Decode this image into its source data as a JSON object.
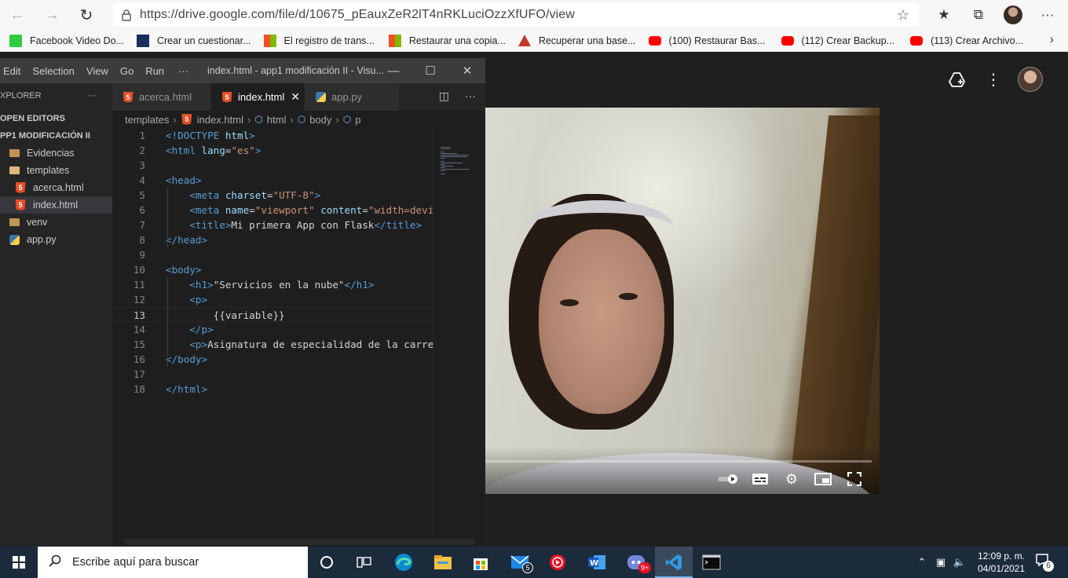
{
  "browser": {
    "url": "https://drive.google.com/file/d/10675_pEauxZeR2lT4nRKLuciOzzXfUFO/view",
    "bookmarks": [
      {
        "label": "Facebook Video Do...",
        "icon": "download-icon",
        "color": "#2ecc40"
      },
      {
        "label": "Crear un cuestionar...",
        "icon": "form-icon",
        "color": "#1b2f5e"
      },
      {
        "label": "El registro de trans...",
        "icon": "windows-icon",
        "color": "#f25022"
      },
      {
        "label": "Restaurar una copia...",
        "icon": "windows-icon",
        "color": "#f25022"
      },
      {
        "label": "Recuperar una base...",
        "icon": "triangle-icon",
        "color": "#c0392b"
      },
      {
        "label": "(100) Restaurar Bas...",
        "icon": "youtube-icon",
        "color": "#ff0000"
      },
      {
        "label": "(112) Crear Backup...",
        "icon": "youtube-icon",
        "color": "#ff0000"
      },
      {
        "label": "(113) Crear Archivo...",
        "icon": "youtube-icon",
        "color": "#ff0000"
      }
    ]
  },
  "vscode": {
    "menu": [
      "Edit",
      "Selection",
      "View",
      "Go",
      "Run",
      "···"
    ],
    "title": "index.html - app1 modificación II - Visu...",
    "explorer": {
      "header": "XPLORER",
      "more": "···",
      "open_editors": "OPEN EDITORS",
      "project": "PP1 MODIFICACIÓN II",
      "items": [
        {
          "label": "Evidencias",
          "type": "folder"
        },
        {
          "label": "templates",
          "type": "folder-open"
        },
        {
          "label": "acerca.html",
          "type": "html"
        },
        {
          "label": "index.html",
          "type": "html"
        },
        {
          "label": "venv",
          "type": "folder"
        },
        {
          "label": "app.py",
          "type": "python"
        }
      ]
    },
    "tabs": [
      {
        "label": "acerca.html",
        "type": "html"
      },
      {
        "label": "index.html",
        "type": "html",
        "active": true
      },
      {
        "label": "app.py",
        "type": "python"
      }
    ],
    "breadcrumb": [
      "templates",
      "index.html",
      "html",
      "body",
      "p"
    ],
    "code_lines": [
      {
        "n": "1",
        "parts": [
          [
            "t-tag",
            "<!DOCTYPE "
          ],
          [
            "t-attr",
            "html"
          ],
          [
            "t-tag",
            ">"
          ]
        ]
      },
      {
        "n": "2",
        "parts": [
          [
            "t-tag",
            "<html "
          ],
          [
            "t-attr",
            "lang"
          ],
          [
            "t-txt",
            "="
          ],
          [
            "t-str",
            "\"es\""
          ],
          [
            "t-tag",
            ">"
          ]
        ]
      },
      {
        "n": "3",
        "parts": []
      },
      {
        "n": "4",
        "parts": [
          [
            "t-tag",
            "<head>"
          ]
        ]
      },
      {
        "n": "5",
        "parts": [
          [
            "t-txt",
            "    "
          ],
          [
            "t-tag",
            "<meta "
          ],
          [
            "t-attr",
            "charset"
          ],
          [
            "t-txt",
            "="
          ],
          [
            "t-str",
            "\"UTF-8\""
          ],
          [
            "t-tag",
            ">"
          ]
        ]
      },
      {
        "n": "6",
        "parts": [
          [
            "t-txt",
            "    "
          ],
          [
            "t-tag",
            "<meta "
          ],
          [
            "t-attr",
            "name"
          ],
          [
            "t-txt",
            "="
          ],
          [
            "t-str",
            "\"viewport\""
          ],
          [
            "t-txt",
            " "
          ],
          [
            "t-attr",
            "content"
          ],
          [
            "t-txt",
            "="
          ],
          [
            "t-str",
            "\"width=devi"
          ]
        ]
      },
      {
        "n": "7",
        "parts": [
          [
            "t-txt",
            "    "
          ],
          [
            "t-tag",
            "<title>"
          ],
          [
            "t-txt",
            "Mi primera App con Flask"
          ],
          [
            "t-tag",
            "</title>"
          ]
        ]
      },
      {
        "n": "8",
        "parts": [
          [
            "t-tag",
            "</head>"
          ]
        ]
      },
      {
        "n": "9",
        "parts": []
      },
      {
        "n": "10",
        "parts": [
          [
            "t-tag",
            "<body>"
          ]
        ]
      },
      {
        "n": "11",
        "parts": [
          [
            "t-txt",
            "    "
          ],
          [
            "t-tag",
            "<h1>"
          ],
          [
            "t-txt",
            "\"Servicios en la nube\""
          ],
          [
            "t-tag",
            "</h1>"
          ]
        ]
      },
      {
        "n": "12",
        "parts": [
          [
            "t-txt",
            "    "
          ],
          [
            "t-tag",
            "<p>"
          ]
        ]
      },
      {
        "n": "13",
        "parts": [
          [
            "t-txt",
            "        {{variable}}"
          ]
        ],
        "current": true
      },
      {
        "n": "14",
        "parts": [
          [
            "t-txt",
            "    "
          ],
          [
            "t-tag",
            "</p>"
          ]
        ]
      },
      {
        "n": "15",
        "parts": [
          [
            "t-txt",
            "    "
          ],
          [
            "t-tag",
            "<p>"
          ],
          [
            "t-txt",
            "Asignatura de especialidad de la carre"
          ]
        ]
      },
      {
        "n": "16",
        "parts": [
          [
            "t-tag",
            "</body>"
          ]
        ]
      },
      {
        "n": "17",
        "parts": []
      },
      {
        "n": "18",
        "parts": [
          [
            "t-tag",
            "</html>"
          ]
        ]
      }
    ]
  },
  "video": {
    "progress": 0.0
  },
  "taskbar": {
    "search_placeholder": "Escribe aquí para buscar",
    "mail_badge": "5",
    "discord_badge": "9+",
    "time": "12:09 p. m.",
    "date": "04/01/2021",
    "notifications": "6"
  }
}
